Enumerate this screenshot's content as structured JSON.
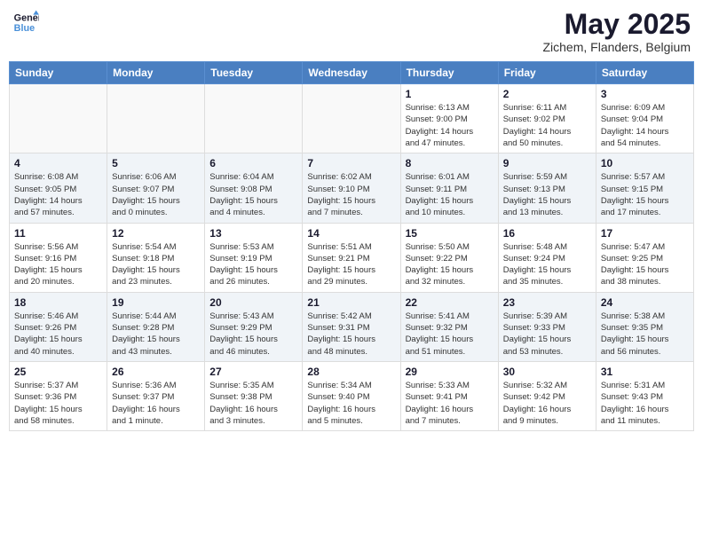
{
  "header": {
    "logo_line1": "General",
    "logo_line2": "Blue",
    "month": "May 2025",
    "location": "Zichem, Flanders, Belgium"
  },
  "days_of_week": [
    "Sunday",
    "Monday",
    "Tuesday",
    "Wednesday",
    "Thursday",
    "Friday",
    "Saturday"
  ],
  "weeks": [
    [
      {
        "day": "",
        "info": ""
      },
      {
        "day": "",
        "info": ""
      },
      {
        "day": "",
        "info": ""
      },
      {
        "day": "",
        "info": ""
      },
      {
        "day": "1",
        "info": "Sunrise: 6:13 AM\nSunset: 9:00 PM\nDaylight: 14 hours\nand 47 minutes."
      },
      {
        "day": "2",
        "info": "Sunrise: 6:11 AM\nSunset: 9:02 PM\nDaylight: 14 hours\nand 50 minutes."
      },
      {
        "day": "3",
        "info": "Sunrise: 6:09 AM\nSunset: 9:04 PM\nDaylight: 14 hours\nand 54 minutes."
      }
    ],
    [
      {
        "day": "4",
        "info": "Sunrise: 6:08 AM\nSunset: 9:05 PM\nDaylight: 14 hours\nand 57 minutes."
      },
      {
        "day": "5",
        "info": "Sunrise: 6:06 AM\nSunset: 9:07 PM\nDaylight: 15 hours\nand 0 minutes."
      },
      {
        "day": "6",
        "info": "Sunrise: 6:04 AM\nSunset: 9:08 PM\nDaylight: 15 hours\nand 4 minutes."
      },
      {
        "day": "7",
        "info": "Sunrise: 6:02 AM\nSunset: 9:10 PM\nDaylight: 15 hours\nand 7 minutes."
      },
      {
        "day": "8",
        "info": "Sunrise: 6:01 AM\nSunset: 9:11 PM\nDaylight: 15 hours\nand 10 minutes."
      },
      {
        "day": "9",
        "info": "Sunrise: 5:59 AM\nSunset: 9:13 PM\nDaylight: 15 hours\nand 13 minutes."
      },
      {
        "day": "10",
        "info": "Sunrise: 5:57 AM\nSunset: 9:15 PM\nDaylight: 15 hours\nand 17 minutes."
      }
    ],
    [
      {
        "day": "11",
        "info": "Sunrise: 5:56 AM\nSunset: 9:16 PM\nDaylight: 15 hours\nand 20 minutes."
      },
      {
        "day": "12",
        "info": "Sunrise: 5:54 AM\nSunset: 9:18 PM\nDaylight: 15 hours\nand 23 minutes."
      },
      {
        "day": "13",
        "info": "Sunrise: 5:53 AM\nSunset: 9:19 PM\nDaylight: 15 hours\nand 26 minutes."
      },
      {
        "day": "14",
        "info": "Sunrise: 5:51 AM\nSunset: 9:21 PM\nDaylight: 15 hours\nand 29 minutes."
      },
      {
        "day": "15",
        "info": "Sunrise: 5:50 AM\nSunset: 9:22 PM\nDaylight: 15 hours\nand 32 minutes."
      },
      {
        "day": "16",
        "info": "Sunrise: 5:48 AM\nSunset: 9:24 PM\nDaylight: 15 hours\nand 35 minutes."
      },
      {
        "day": "17",
        "info": "Sunrise: 5:47 AM\nSunset: 9:25 PM\nDaylight: 15 hours\nand 38 minutes."
      }
    ],
    [
      {
        "day": "18",
        "info": "Sunrise: 5:46 AM\nSunset: 9:26 PM\nDaylight: 15 hours\nand 40 minutes."
      },
      {
        "day": "19",
        "info": "Sunrise: 5:44 AM\nSunset: 9:28 PM\nDaylight: 15 hours\nand 43 minutes."
      },
      {
        "day": "20",
        "info": "Sunrise: 5:43 AM\nSunset: 9:29 PM\nDaylight: 15 hours\nand 46 minutes."
      },
      {
        "day": "21",
        "info": "Sunrise: 5:42 AM\nSunset: 9:31 PM\nDaylight: 15 hours\nand 48 minutes."
      },
      {
        "day": "22",
        "info": "Sunrise: 5:41 AM\nSunset: 9:32 PM\nDaylight: 15 hours\nand 51 minutes."
      },
      {
        "day": "23",
        "info": "Sunrise: 5:39 AM\nSunset: 9:33 PM\nDaylight: 15 hours\nand 53 minutes."
      },
      {
        "day": "24",
        "info": "Sunrise: 5:38 AM\nSunset: 9:35 PM\nDaylight: 15 hours\nand 56 minutes."
      }
    ],
    [
      {
        "day": "25",
        "info": "Sunrise: 5:37 AM\nSunset: 9:36 PM\nDaylight: 15 hours\nand 58 minutes."
      },
      {
        "day": "26",
        "info": "Sunrise: 5:36 AM\nSunset: 9:37 PM\nDaylight: 16 hours\nand 1 minute."
      },
      {
        "day": "27",
        "info": "Sunrise: 5:35 AM\nSunset: 9:38 PM\nDaylight: 16 hours\nand 3 minutes."
      },
      {
        "day": "28",
        "info": "Sunrise: 5:34 AM\nSunset: 9:40 PM\nDaylight: 16 hours\nand 5 minutes."
      },
      {
        "day": "29",
        "info": "Sunrise: 5:33 AM\nSunset: 9:41 PM\nDaylight: 16 hours\nand 7 minutes."
      },
      {
        "day": "30",
        "info": "Sunrise: 5:32 AM\nSunset: 9:42 PM\nDaylight: 16 hours\nand 9 minutes."
      },
      {
        "day": "31",
        "info": "Sunrise: 5:31 AM\nSunset: 9:43 PM\nDaylight: 16 hours\nand 11 minutes."
      }
    ]
  ]
}
